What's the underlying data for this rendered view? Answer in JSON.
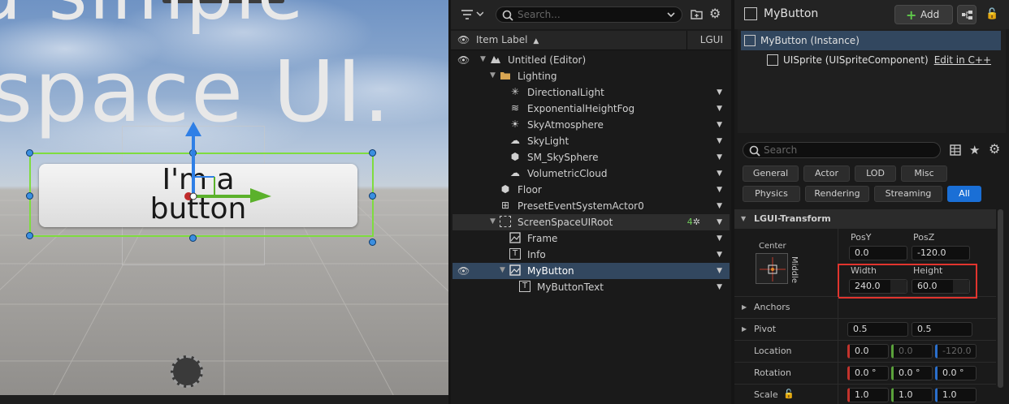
{
  "viewport": {
    "text_top": "a simple",
    "text_main": "space UI.",
    "button_text_line1": "I'm a",
    "button_text_line2": "button"
  },
  "outliner": {
    "search_placeholder": "Search...",
    "header": {
      "label": "Item Label",
      "type_col": "LGUI"
    },
    "rows": [
      {
        "name": "Untitled (Editor)",
        "icon": "level-icon"
      },
      {
        "name": "Lighting",
        "icon": "folder-icon"
      },
      {
        "name": "DirectionalLight",
        "icon": "sun-icon"
      },
      {
        "name": "ExponentialHeightFog",
        "icon": "fog-icon"
      },
      {
        "name": "SkyAtmosphere",
        "icon": "atmosphere-icon"
      },
      {
        "name": "SkyLight",
        "icon": "skylight-icon"
      },
      {
        "name": "SM_SkySphere",
        "icon": "mesh-icon"
      },
      {
        "name": "VolumetricCloud",
        "icon": "cloud-icon"
      },
      {
        "name": "Floor",
        "icon": "mesh-icon"
      },
      {
        "name": "PresetEventSystemActor0",
        "icon": "actor-icon"
      },
      {
        "name": "ScreenSpaceUIRoot",
        "icon": "uiroot-icon",
        "badge": "4"
      },
      {
        "name": "Frame",
        "icon": "sprite-icon"
      },
      {
        "name": "Info",
        "icon": "text-icon"
      },
      {
        "name": "MyButton",
        "icon": "sprite-icon"
      },
      {
        "name": "MyButtonText",
        "icon": "text-icon"
      }
    ]
  },
  "details": {
    "title": "MyButton",
    "add_label": "Add",
    "components": {
      "root": "MyButton (Instance)",
      "child": "UISprite (UISpriteComponent)",
      "edit_link": "Edit in C++"
    },
    "search_placeholder": "Search",
    "filters": [
      "General",
      "Actor",
      "LOD",
      "Misc",
      "Physics",
      "Rendering",
      "Streaming",
      "All"
    ],
    "active_filter": "All",
    "section": "LGUI-Transform",
    "anchor": {
      "h": "Center",
      "v": "Middle"
    },
    "posy_label": "PosY",
    "posz_label": "PosZ",
    "posy": "0.0",
    "posz": "-120.0",
    "width_label": "Width",
    "height_label": "Height",
    "width": "240.0",
    "height": "60.0",
    "anchors_label": "Anchors",
    "pivot_label": "Pivot",
    "pivot": [
      "0.5",
      "0.5"
    ],
    "location_label": "Location",
    "location": [
      "0.0",
      "0.0",
      "-120.0"
    ],
    "rotation_label": "Rotation",
    "rotation": [
      "0.0 °",
      "0.0 °",
      "0.0 °"
    ],
    "scale_label": "Scale",
    "scale": [
      "1.0",
      "1.0",
      "1.0"
    ]
  }
}
